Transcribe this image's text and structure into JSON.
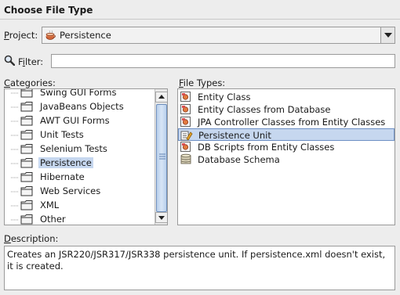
{
  "header": {
    "title": "Choose File Type"
  },
  "project": {
    "label_u": "P",
    "label_rest": "roject:",
    "value": "Persistence",
    "icon": "coffee-cup-icon"
  },
  "filter": {
    "label_pre": "F",
    "label_u": "i",
    "label_rest": "lter:",
    "value": "",
    "icon": "magnifier-icon"
  },
  "categories": {
    "label_u": "C",
    "label_rest": "ategories:",
    "items": [
      "Swing GUI Forms",
      "JavaBeans Objects",
      "AWT GUI Forms",
      "Unit Tests",
      "Selenium Tests",
      "Persistence",
      "Hibernate",
      "Web Services",
      "XML",
      "Other"
    ],
    "selected": "Persistence",
    "item_icon": "folder-icon"
  },
  "file_types": {
    "label_u": "F",
    "label_rest": "ile Types:",
    "items": [
      {
        "label": "Entity Class",
        "icon": "entity-icon"
      },
      {
        "label": "Entity Classes from Database",
        "icon": "entity-icon"
      },
      {
        "label": "JPA Controller Classes from Entity Classes",
        "icon": "entity-icon"
      },
      {
        "label": "Persistence Unit",
        "icon": "persistence-unit-icon"
      },
      {
        "label": "DB Scripts from Entity Classes",
        "icon": "entity-icon"
      },
      {
        "label": "Database Schema",
        "icon": "database-icon"
      }
    ],
    "selected": "Persistence Unit"
  },
  "description": {
    "label_u": "D",
    "label_rest": "escription:",
    "line1": "Creates an JSR220/JSR317/JSR338 persistence unit. If persistence.xml doesn't exist,",
    "line2": "it is created."
  },
  "colors": {
    "selection": "#c6d7ef",
    "selection_border": "#6d8fc4",
    "background": "#ededed"
  }
}
